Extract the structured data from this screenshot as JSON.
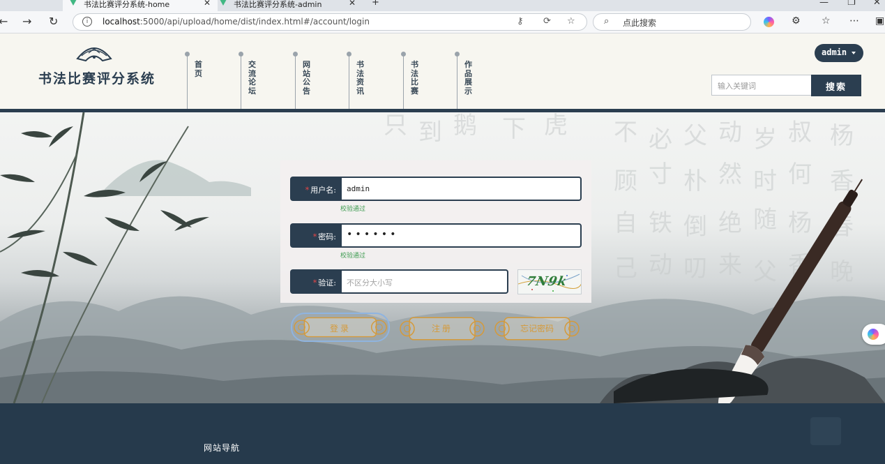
{
  "browser": {
    "tabs": [
      {
        "title": "书法比赛评分系统-home",
        "active": true
      },
      {
        "title": "书法比赛评分系统-admin",
        "active": false
      }
    ],
    "new_tab": "+",
    "window_controls": {
      "minimize": "—",
      "restore": "❐",
      "close": "✕"
    },
    "url_host": "localhost",
    "url_rest": ":5000/api/upload/home/dist/index.html#/account/login",
    "search_placeholder": "点此搜索"
  },
  "header": {
    "site_title": "书法比赛评分系统",
    "nav": [
      "首页",
      "交流论坛",
      "网站公告",
      "书法资讯",
      "书法比赛",
      "作品展示"
    ],
    "user_label": "admin",
    "keyword_placeholder": "输入关键词",
    "search_button": "搜索"
  },
  "login": {
    "username_label": "用户名:",
    "username_value": "admin",
    "username_hint": "校验通过",
    "password_label": "密码:",
    "password_value": "••••••",
    "password_hint": "校验通过",
    "captcha_label": "验证:",
    "captcha_placeholder": "不区分大小写",
    "captcha_code": "7N9k",
    "captcha_color": "#2f7d3a",
    "buttons": {
      "login": "登录",
      "register": "注册",
      "forgot": "忘记密码"
    }
  },
  "footer": {
    "nav_title": "网站导航"
  },
  "colors": {
    "primary": "#2b3e50",
    "hint_green": "#3f9c52",
    "required_red": "#e64646",
    "button_gold": "#d59a3a"
  }
}
